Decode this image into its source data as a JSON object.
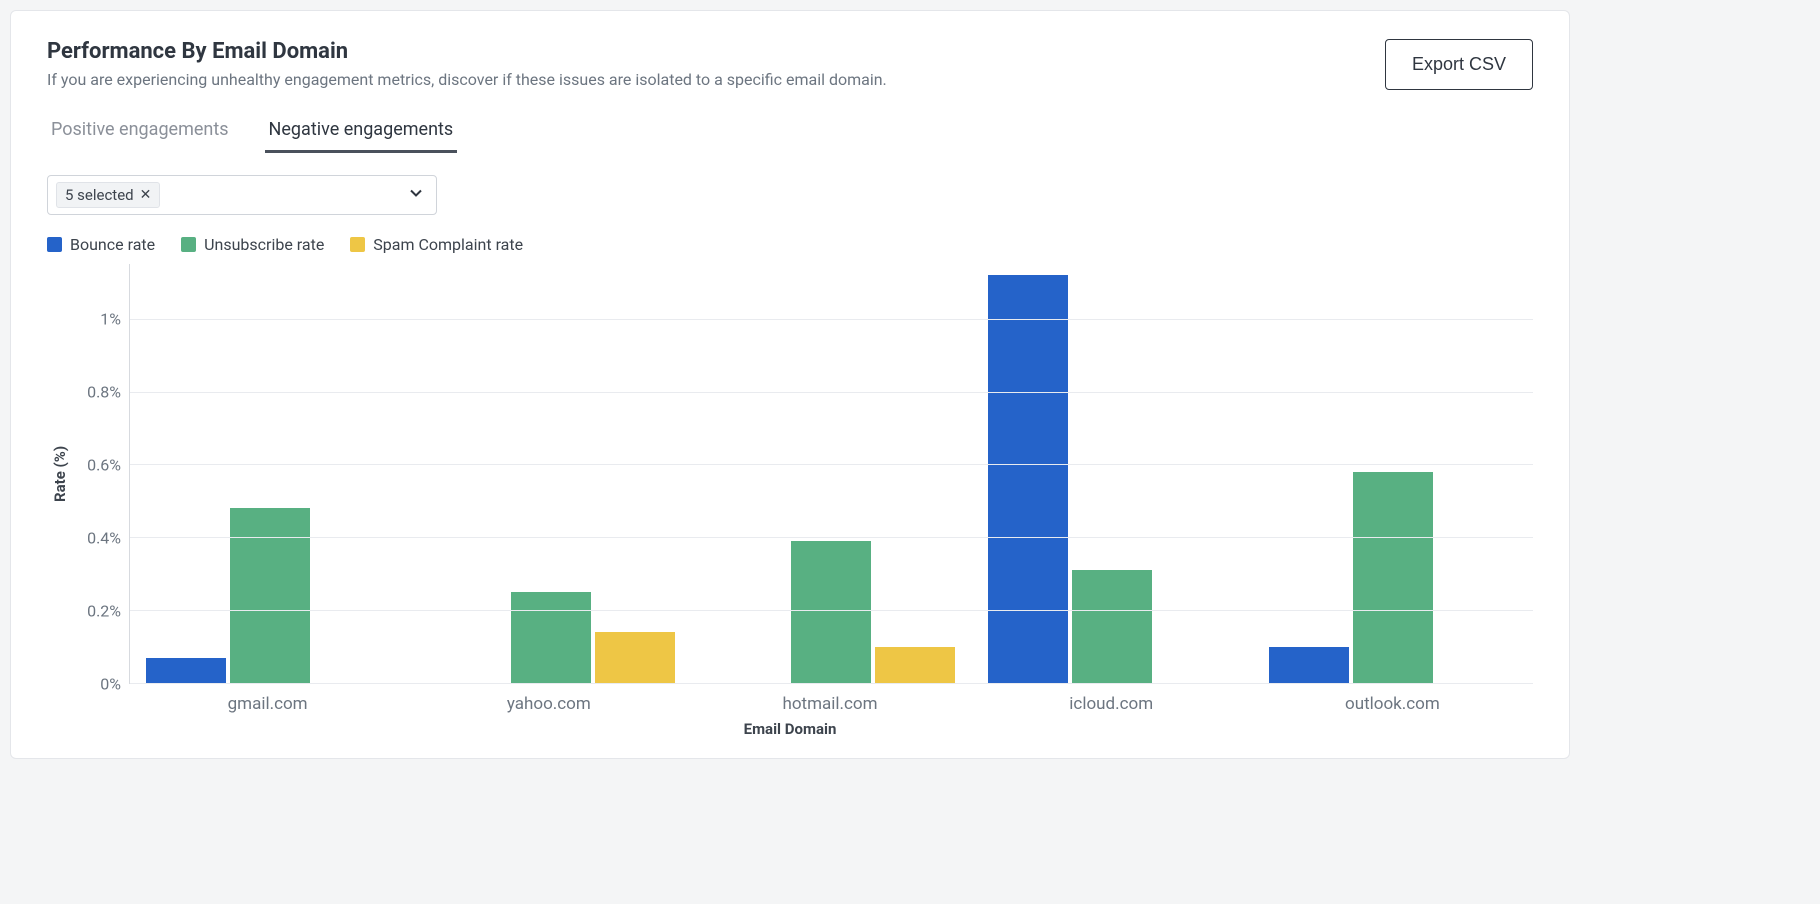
{
  "header": {
    "title": "Performance By Email Domain",
    "subtitle": "If you are experiencing unhealthy engagement metrics, discover if these issues are isolated to a specific email domain.",
    "export_label": "Export CSV"
  },
  "tabs": {
    "positive": "Positive engagements",
    "negative": "Negative engagements",
    "active": "negative"
  },
  "filter": {
    "chip_label": "5 selected"
  },
  "legend": [
    {
      "name": "Bounce rate",
      "color": "#2563c9"
    },
    {
      "name": "Unsubscribe rate",
      "color": "#58b082"
    },
    {
      "name": "Spam Complaint rate",
      "color": "#eec645"
    }
  ],
  "chart_data": {
    "type": "bar",
    "xlabel": "Email Domain",
    "ylabel": "Rate (%)",
    "ylim": [
      0,
      1.15
    ],
    "yticks": [
      0,
      0.2,
      0.4,
      0.6,
      0.8,
      1
    ],
    "ytick_labels": [
      "0%",
      "0.2%",
      "0.4%",
      "0.6%",
      "0.8%",
      "1%"
    ],
    "categories": [
      "gmail.com",
      "yahoo.com",
      "hotmail.com",
      "icloud.com",
      "outlook.com"
    ],
    "series": [
      {
        "name": "Bounce rate",
        "color": "#2563c9",
        "values": [
          0.07,
          0.0,
          0.0,
          1.12,
          0.1
        ]
      },
      {
        "name": "Unsubscribe rate",
        "color": "#58b082",
        "values": [
          0.48,
          0.25,
          0.39,
          0.31,
          0.58
        ]
      },
      {
        "name": "Spam Complaint rate",
        "color": "#eec645",
        "values": [
          0.0,
          0.14,
          0.1,
          0.0,
          0.0
        ]
      }
    ]
  }
}
